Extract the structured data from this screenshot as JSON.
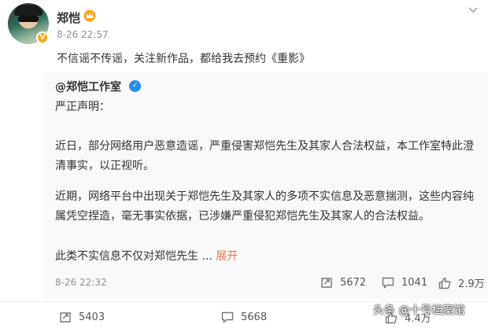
{
  "post": {
    "username": "郑恺",
    "timestamp": "8-26 22:57",
    "text": "不信谣不传谣，关注新作品，都给我去预约《重影》"
  },
  "repost": {
    "username": "@郑恺工作室",
    "title": "严正声明：",
    "paragraph1": "近日，部分网络用户恶意造谣，严重侵害郑恺先生及其家人合法权益，本工作室特此澄清事实，以正视听。",
    "paragraph2": "近期，网络平台中出现关于郑恺先生及其家人的多项不实信息及恶意揣测，这些内容纯属凭空捏造，毫无事实依据，已涉嫌严重侵犯郑恺先生及其家人的合法权益。",
    "paragraph3": "此类不实信息不仅对郑恺先生",
    "ellipsis": " ... ",
    "expand_label": "展开",
    "timestamp": "8-26 22:32",
    "reposts": "5672",
    "comments": "1041",
    "likes": "2.9万"
  },
  "actions": {
    "reposts": "5403",
    "comments": "5668",
    "likes": "4.4万"
  },
  "watermark": "头条 @十号档案馆",
  "colors": {
    "accent_orange": "#eb7350",
    "verified_blue": "#2a8cf0",
    "verified_gold": "#f7a81b"
  }
}
